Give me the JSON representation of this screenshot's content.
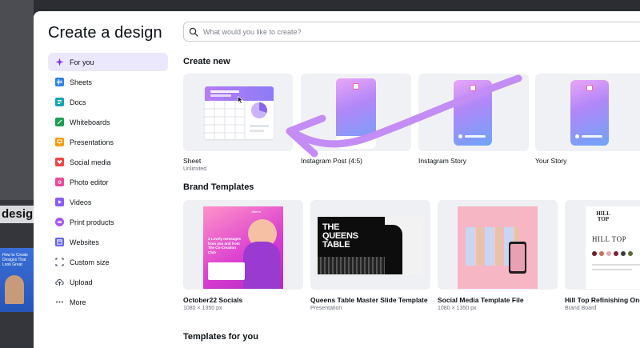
{
  "background": {
    "partial_word": "design",
    "thumb_text": "How to Create Designs That Look Great"
  },
  "modal": {
    "title": "Create a design",
    "search_placeholder": "What would you like to create?"
  },
  "nav": {
    "items": [
      {
        "label": "For you",
        "icon": "sparkle-icon",
        "color": "#7d2ae8",
        "active": true
      },
      {
        "label": "Sheets",
        "icon": "sheets-icon",
        "color": "#2f80ed"
      },
      {
        "label": "Docs",
        "icon": "docs-icon",
        "color": "#13a3b5"
      },
      {
        "label": "Whiteboards",
        "icon": "whiteboard-icon",
        "color": "#1f9d55"
      },
      {
        "label": "Presentations",
        "icon": "presentation-icon",
        "color": "#f59e0b"
      },
      {
        "label": "Social media",
        "icon": "heart-icon",
        "color": "#ef4444"
      },
      {
        "label": "Photo editor",
        "icon": "camera-icon",
        "color": "#ec4899"
      },
      {
        "label": "Videos",
        "icon": "video-icon",
        "color": "#8b5cf6"
      },
      {
        "label": "Print products",
        "icon": "printer-icon",
        "color": "#a855f7"
      },
      {
        "label": "Websites",
        "icon": "website-icon",
        "color": "#6366f1"
      },
      {
        "label": "Custom size",
        "icon": "resize-icon",
        "color": "#374151"
      },
      {
        "label": "Upload",
        "icon": "cloud-upload-icon",
        "color": "#374151"
      },
      {
        "label": "More",
        "icon": "more-dots-icon",
        "color": "#374151"
      }
    ]
  },
  "create_new": {
    "title": "Create new",
    "cards": [
      {
        "label": "Sheet",
        "sub": "Unlimited"
      },
      {
        "label": "Instagram Post (4:5)",
        "sub": ""
      },
      {
        "label": "Instagram Story",
        "sub": ""
      },
      {
        "label": "Your Story",
        "sub": ""
      }
    ]
  },
  "brand_templates": {
    "title": "Brand Templates",
    "cards": [
      {
        "label": "October22 Socials",
        "sub": "1080 × 1350 px",
        "inner_text": "3 Lovely messages from you and from The Co-Creation Club"
      },
      {
        "label": "Queens Table Master Slide Template",
        "sub": "Presentation",
        "inner_text": "THE QUEENS TABLE"
      },
      {
        "label": "Social Media Template File",
        "sub": "1080 × 1350 px",
        "inner_text": ""
      },
      {
        "label": "Hill Top Refinishing One",
        "sub": "Brand Board",
        "inner_text": "HILL TOP"
      }
    ]
  },
  "templates_for_you": {
    "title": "Templates for you"
  },
  "colors": {
    "accent": "#7d2ae8",
    "nav_active_bg": "#ebe7fd",
    "arrow": "#c48cf5"
  }
}
